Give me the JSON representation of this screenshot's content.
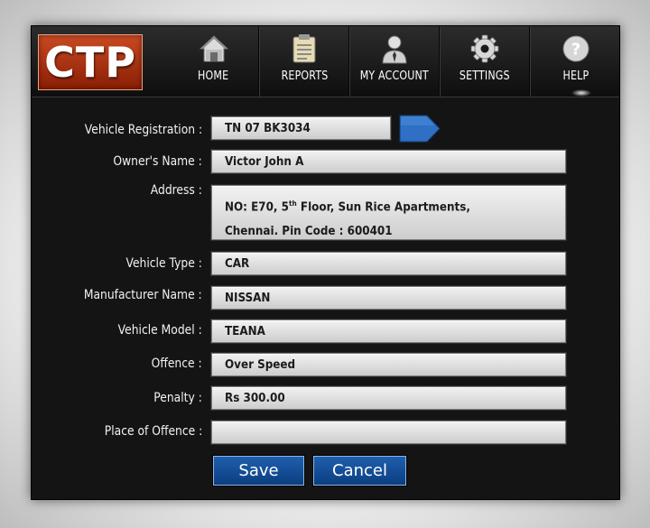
{
  "app": {
    "logo_text": "CTP"
  },
  "nav": [
    {
      "label": "HOME",
      "icon": "home-icon"
    },
    {
      "label": "REPORTS",
      "icon": "clipboard-icon"
    },
    {
      "label": "MY ACCOUNT",
      "icon": "user-icon"
    },
    {
      "label": "SETTINGS",
      "icon": "gear-icon"
    },
    {
      "label": "HELP",
      "icon": "help-icon"
    }
  ],
  "form": {
    "vehicle_registration": {
      "label": "Vehicle Registration :",
      "value": "TN 07 BK3034"
    },
    "owners_name": {
      "label": "Owner's Name :",
      "value": "Victor John A"
    },
    "address": {
      "label": "Address :",
      "line1_prefix": "NO: E70, 5",
      "line1_sup": "th",
      "line1_suffix": " Floor, Sun Rice Apartments,",
      "line2": "Chennai. Pin Code : 600401"
    },
    "vehicle_type": {
      "label": "Vehicle Type :",
      "value": "CAR"
    },
    "manufacturer_name": {
      "label": "Manufacturer Name :",
      "value": "NISSAN"
    },
    "vehicle_model": {
      "label": "Vehicle Model :",
      "value": "TEANA"
    },
    "offence": {
      "label": "Offence :",
      "value": "Over Speed"
    },
    "penalty": {
      "label": "Penalty :",
      "value": "Rs 300.00"
    },
    "place_of_offence": {
      "label": "Place of Offence :",
      "value": ""
    }
  },
  "buttons": {
    "save": "Save",
    "cancel": "Cancel"
  },
  "colors": {
    "logo": "#b53a14",
    "button": "#164f96",
    "arrow": "#2f6fc4",
    "background": "#141414"
  }
}
